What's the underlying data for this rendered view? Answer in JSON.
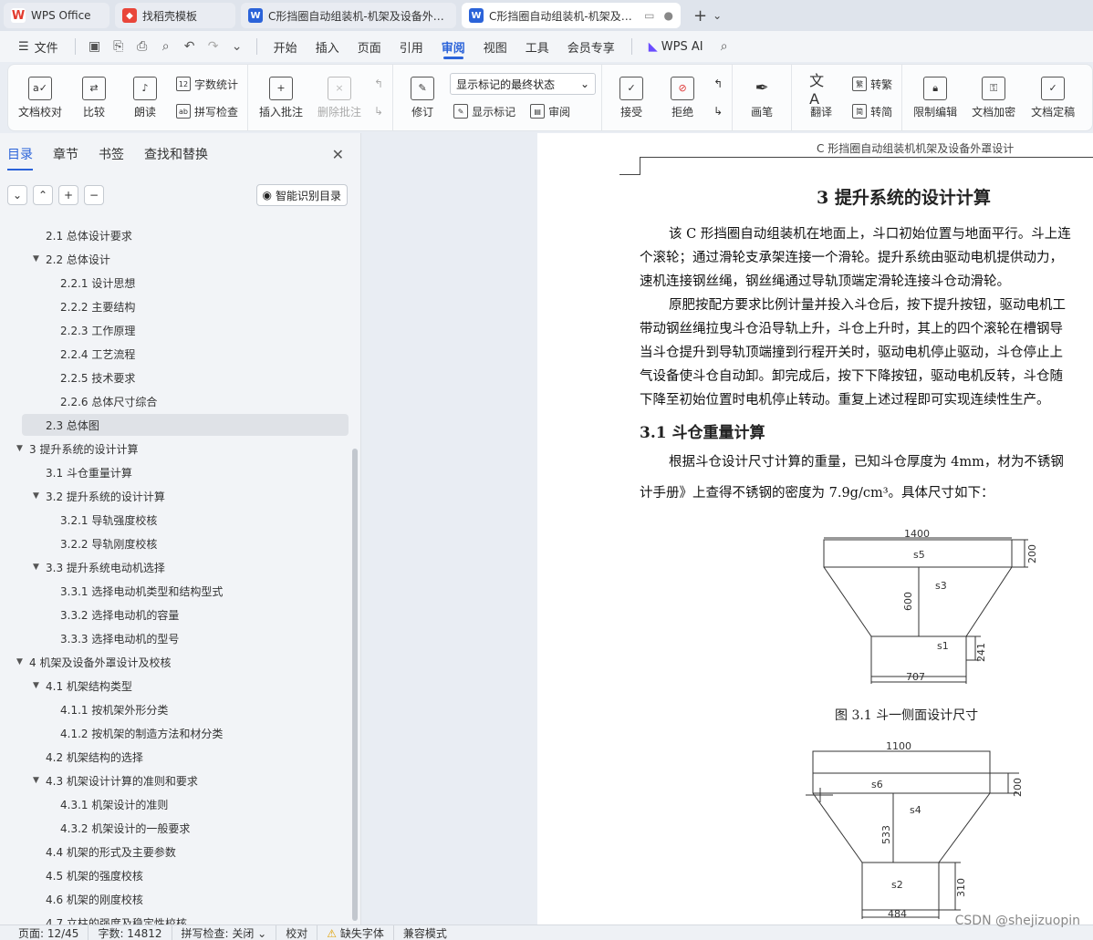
{
  "titlebar": {
    "tabs": [
      {
        "label": "WPS Office",
        "icon": "wps-logo-icon",
        "color": "#e23a2e"
      },
      {
        "label": "找稻壳模板",
        "icon": "docer-icon",
        "color": "#e9463a"
      },
      {
        "label": "C形挡圈自动组装机-机架及设备外罩设",
        "icon": "word-doc-icon",
        "color": "#2b63d9"
      },
      {
        "label": "C形挡圈自动组装机-机架及设备外罩设",
        "icon": "word-doc-icon",
        "color": "#2b63d9"
      }
    ],
    "new_tab": "+",
    "tab_menu": "⌄"
  },
  "menubar": {
    "file": "文件",
    "items": [
      "开始",
      "插入",
      "页面",
      "引用",
      "审阅",
      "视图",
      "工具",
      "会员专享"
    ],
    "active": "审阅",
    "ai": "WPS AI"
  },
  "ribbon": {
    "doc_check": "文档校对",
    "compare": "比较",
    "read_aloud": "朗读",
    "word_count": "字数统计",
    "spell_check": "拼写检查",
    "insert_comment": "插入批注",
    "delete_comment": "删除批注",
    "track": "修订",
    "markup_select": "显示标记的最终状态",
    "show_markup": "显示标记",
    "review": "审阅",
    "accept": "接受",
    "reject": "拒绝",
    "pen": "画笔",
    "translate": "翻译",
    "to_traditional": "转繁",
    "to_simplified": "转简",
    "restrict_edit": "限制编辑",
    "encrypt": "文档加密",
    "finalize": "文档定稿"
  },
  "sidebar": {
    "tabs": [
      "目录",
      "章节",
      "书签",
      "查找和替换"
    ],
    "active_tab": "目录",
    "smart_toc": "智能识别目录",
    "toc": [
      {
        "text": "2.1  总体设计要求",
        "level": 2,
        "arrow": ""
      },
      {
        "text": "2.2  总体设计",
        "level": 2,
        "arrow": "▼"
      },
      {
        "text": "2.2.1  设计思想",
        "level": 3,
        "arrow": ""
      },
      {
        "text": "2.2.2  主要结构",
        "level": 3,
        "arrow": ""
      },
      {
        "text": "2.2.3  工作原理",
        "level": 3,
        "arrow": ""
      },
      {
        "text": "2.2.4  工艺流程",
        "level": 3,
        "arrow": ""
      },
      {
        "text": "2.2.5  技术要求",
        "level": 3,
        "arrow": ""
      },
      {
        "text": "2.2.6  总体尺寸综合",
        "level": 3,
        "arrow": ""
      },
      {
        "text": "2.3  总体图",
        "level": 2,
        "arrow": "",
        "selected": true
      },
      {
        "text": "3  提升系统的设计计算",
        "level": 1,
        "arrow": "▼"
      },
      {
        "text": "3.1  斗仓重量计算",
        "level": 2,
        "arrow": ""
      },
      {
        "text": "3.2  提升系统的设计计算",
        "level": 2,
        "arrow": "▼"
      },
      {
        "text": "3.2.1  导轨强度校核",
        "level": 3,
        "arrow": ""
      },
      {
        "text": "3.2.2  导轨刚度校核",
        "level": 3,
        "arrow": ""
      },
      {
        "text": "3.3  提升系统电动机选择",
        "level": 2,
        "arrow": "▼"
      },
      {
        "text": "3.3.1    选择电动机类型和结构型式",
        "level": 3,
        "arrow": ""
      },
      {
        "text": "3.3.2  选择电动机的容量",
        "level": 3,
        "arrow": ""
      },
      {
        "text": "3.3.3 选择电动机的型号",
        "level": 3,
        "arrow": ""
      },
      {
        "text": "4  机架及设备外罩设计及校核",
        "level": 1,
        "arrow": "▼"
      },
      {
        "text": "4.1 机架结构类型",
        "level": 2,
        "arrow": "▼"
      },
      {
        "text": "4.1.1  按机架外形分类",
        "level": 3,
        "arrow": ""
      },
      {
        "text": "4.1.2  按机架的制造方法和材分类",
        "level": 3,
        "arrow": ""
      },
      {
        "text": "4.2  机架结构的选择",
        "level": 2,
        "arrow": ""
      },
      {
        "text": "4.3  机架设计计算的准则和要求",
        "level": 2,
        "arrow": "▼"
      },
      {
        "text": "4.3.1 机架设计的准则",
        "level": 3,
        "arrow": ""
      },
      {
        "text": "4.3.2  机架设计的一般要求",
        "level": 3,
        "arrow": ""
      },
      {
        "text": "4.4  机架的形式及主要参数",
        "level": 2,
        "arrow": ""
      },
      {
        "text": "4.5 机架的强度校核",
        "level": 2,
        "arrow": ""
      },
      {
        "text": "4.6 机架的刚度校核",
        "level": 2,
        "arrow": ""
      },
      {
        "text": "4.7 立柱的强度及稳定性校核",
        "level": 2,
        "arrow": ""
      }
    ]
  },
  "document": {
    "header": "C 形挡圈自动组装机机架及设备外罩设计",
    "heading1": "3  提升系统的设计计算",
    "paragraphs": [
      "该 C 形挡圈自动组装机在地面上，斗口初始位置与地面平行。斗上连",
      "个滚轮；通过滑轮支承架连接一个滑轮。提升系统由驱动电机提供动力，",
      "速机连接钢丝绳，钢丝绳通过导轨顶端定滑轮连接斗仓动滑轮。",
      "原肥按配方要求比例计量并投入斗仓后，按下提升按钮，驱动电机工",
      "带动钢丝绳拉曳斗仓沿导轨上升，斗仓上升时，其上的四个滚轮在槽钢导",
      "当斗仓提升到导轨顶端撞到行程开关时，驱动电机停止驱动，斗仓停止上",
      "气设备使斗仓自动卸。卸完成后，按下下降按钮，驱动电机反转，斗仓随",
      "下降至初始位置时电机停止转动。重复上述过程即可实现连续性生产。"
    ],
    "heading2": "3.1  斗仓重量计算",
    "para2_line1": "根据斗仓设计尺寸计算的重量，已知斗仓厚度为 4mm，材为不锈钢",
    "para2_line2": "计手册》上查得不锈钢的密度为 7.9g/cm³。具体尺寸如下：",
    "caption1": "图 3.1 斗一侧面设计尺寸",
    "fig1": {
      "top": "1400",
      "h_top": "200",
      "mid": "600",
      "bottom": "707",
      "h_bottom": "241",
      "s_top": "s5",
      "s_mid": "s3",
      "s_bot": "s1"
    },
    "fig2": {
      "top": "1100",
      "h_top": "200",
      "mid": "533",
      "bottom": "484",
      "h_bottom": "310",
      "s_top": "s6",
      "s_mid": "s4",
      "s_bot": "s2"
    }
  },
  "statusbar": {
    "page": "页面: 12/45",
    "words": "字数: 14812",
    "spell": "拼写检查: 关闭",
    "proof": "校对",
    "missing_font": "缺失字体",
    "compat": "兼容模式"
  },
  "watermark": "CSDN @shejizuopin",
  "colors": {
    "accent": "#2b63d9",
    "wps_red": "#e23a2e"
  }
}
